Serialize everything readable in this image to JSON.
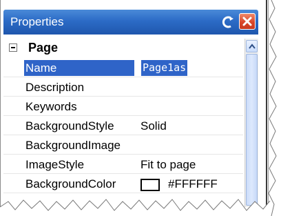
{
  "window": {
    "title": "Properties",
    "pin_icon": "auto-hide-pin-icon",
    "close_icon": "close-icon"
  },
  "category": {
    "label": "Page",
    "expander": "collapse-icon"
  },
  "properties": [
    {
      "name": "Name",
      "value": "Page1as",
      "selected": true
    },
    {
      "name": "Description",
      "value": ""
    },
    {
      "name": "Keywords",
      "value": ""
    },
    {
      "name": "BackgroundStyle",
      "value": "Solid"
    },
    {
      "name": "BackgroundImage",
      "value": ""
    },
    {
      "name": "ImageStyle",
      "value": "Fit to page"
    },
    {
      "name": "BackgroundColor",
      "value": "#FFFFFF",
      "swatch_color": "#FFFFFF"
    }
  ],
  "colors": {
    "title_bar": "#2c6bc6",
    "selection": "#2f64c8",
    "close_button": "#d9472a"
  }
}
